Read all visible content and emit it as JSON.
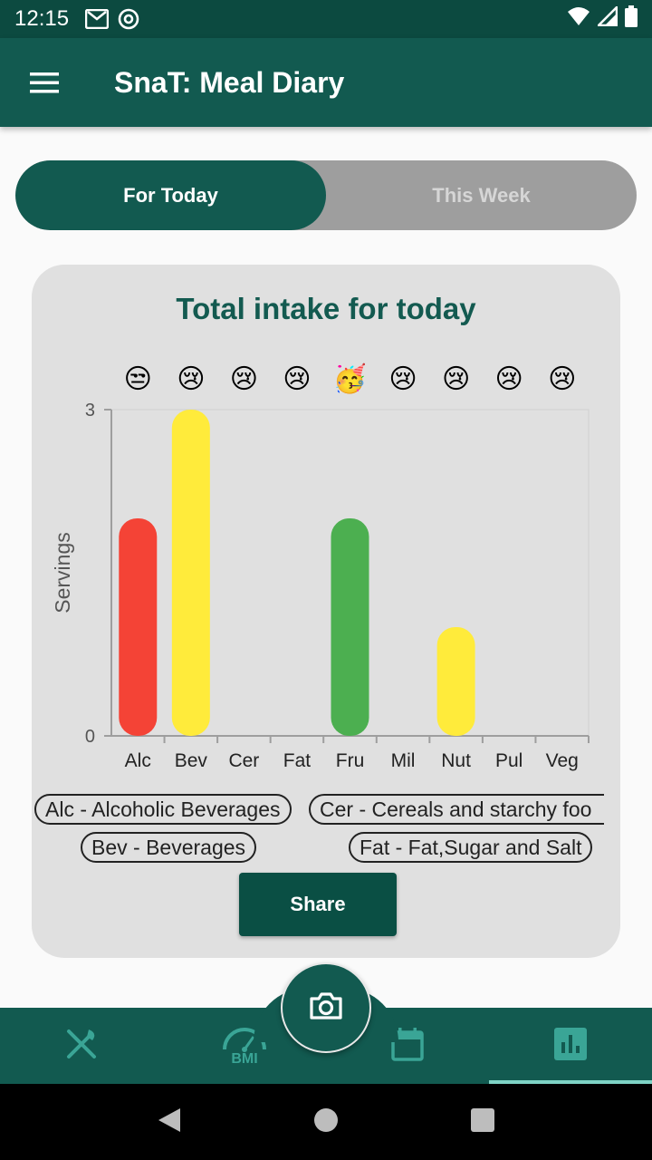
{
  "status_bar": {
    "time": "12:15"
  },
  "app_bar": {
    "title": "SnaT: Meal Diary"
  },
  "tabs": [
    {
      "label": "For Today",
      "active": true
    },
    {
      "label": "This Week",
      "active": false
    }
  ],
  "card": {
    "title": "Total intake for today",
    "share_label": "Share",
    "legend": [
      "Alc - Alcoholic Beverages",
      "Cer - Cereals and starchy foo",
      "Bev - Beverages",
      "Fat - Fat,Sugar and Salt"
    ]
  },
  "chart_data": {
    "type": "bar",
    "categories": [
      "Alc",
      "Bev",
      "Cer",
      "Fat",
      "Fru",
      "Mil",
      "Nut",
      "Pul",
      "Veg"
    ],
    "values": [
      2,
      3,
      0,
      0,
      2,
      0,
      1,
      0,
      0
    ],
    "bar_colors": [
      "#f44336",
      "#ffeb3b",
      "#ffeb3b",
      "#ffeb3b",
      "#4caf50",
      "#ffeb3b",
      "#ffeb3b",
      "#ffeb3b",
      "#ffeb3b"
    ],
    "emojis": [
      "😒",
      "😢",
      "😢",
      "😢",
      "🥳",
      "😢",
      "😢",
      "😢",
      "😢"
    ],
    "ylabel": "Servings",
    "ylim": [
      0,
      3
    ],
    "yticks": [
      "0",
      "3"
    ]
  },
  "colors": {
    "primary": "#125a50",
    "primary_dark": "#0c4a40",
    "accent": "#7fd3c6",
    "card_bg": "#e0e0e0"
  },
  "bottom_nav": {
    "items": [
      "fork-knife-icon",
      "bmi-gauge-icon",
      "calendar-icon",
      "bar-chart-icon"
    ],
    "bmi_label": "BMI",
    "selected": 3
  }
}
